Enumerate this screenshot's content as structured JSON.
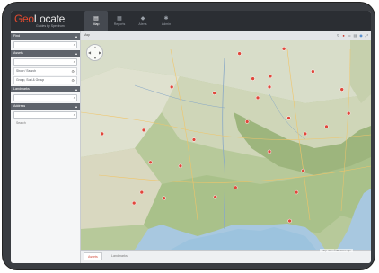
{
  "app": {
    "logo_first": "Geo",
    "logo_rest": "Locate",
    "logo_sub": "Guides by Spectrum"
  },
  "nav": [
    {
      "label": "Map",
      "icon": "map-icon"
    },
    {
      "label": "Reports",
      "icon": "reports-icon"
    },
    {
      "label": "Alerts",
      "icon": "alerts-icon"
    },
    {
      "label": "Admin",
      "icon": "admin-icon"
    }
  ],
  "sidebar": {
    "search": {
      "header": "Find",
      "placeholder": "Type a Unit Name"
    },
    "assets": {
      "header": "Assets",
      "search_placeholder": "Search",
      "items": [
        "Show / Search",
        "Group, Sort & Group"
      ]
    },
    "landmarks": {
      "header": "Landmarks",
      "search_placeholder": "Search"
    },
    "address": {
      "header": "Address",
      "search_placeholder": "Search"
    }
  },
  "map": {
    "header_title": "Map",
    "footer_tabs": [
      "Assets",
      "Landmarks"
    ],
    "active_tab": 0,
    "attribution": "Map data ©2013 Google"
  },
  "markers": [
    {
      "lng": -84.4,
      "lat": 40.0
    },
    {
      "lng": -90.2,
      "lat": 38.6
    },
    {
      "lng": -86.8,
      "lat": 36.2
    },
    {
      "lng": -84.5,
      "lat": 33.7
    },
    {
      "lng": -81.7,
      "lat": 30.3
    },
    {
      "lng": -82.4,
      "lat": 27.9
    },
    {
      "lng": -90.1,
      "lat": 29.9
    },
    {
      "lng": -95.4,
      "lat": 29.8
    },
    {
      "lng": -97.7,
      "lat": 30.3
    },
    {
      "lng": -96.8,
      "lat": 32.8
    },
    {
      "lng": -97.5,
      "lat": 35.5
    },
    {
      "lng": -94.6,
      "lat": 39.1
    },
    {
      "lng": -87.6,
      "lat": 41.9
    },
    {
      "lng": -83.0,
      "lat": 42.3
    },
    {
      "lng": -80.0,
      "lat": 40.4
    },
    {
      "lng": -77.0,
      "lat": 38.9
    },
    {
      "lng": -78.6,
      "lat": 35.8
    },
    {
      "lng": -80.8,
      "lat": 35.2
    },
    {
      "lng": -86.2,
      "lat": 39.8
    },
    {
      "lng": -81.0,
      "lat": 32.1
    },
    {
      "lng": -92.3,
      "lat": 34.7
    },
    {
      "lng": -88.0,
      "lat": 30.7
    },
    {
      "lng": -85.7,
      "lat": 38.2
    },
    {
      "lng": -101.8,
      "lat": 35.2
    },
    {
      "lng": -98.5,
      "lat": 29.4
    },
    {
      "lng": -93.7,
      "lat": 32.5
    },
    {
      "lng": -82.5,
      "lat": 36.5
    },
    {
      "lng": -84.5,
      "lat": 39.1
    },
    {
      "lng": -76.3,
      "lat": 36.9
    }
  ]
}
